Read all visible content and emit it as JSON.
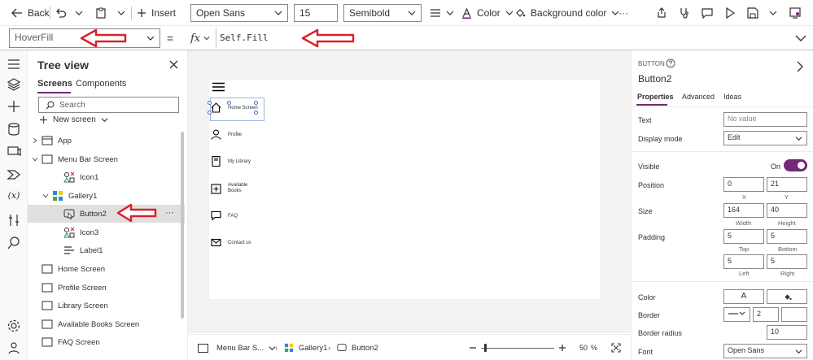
{
  "toolbar": {
    "back_label": "Back",
    "insert_label": "Insert",
    "font_family": "Open Sans",
    "font_size": "15",
    "font_weight": "Semibold",
    "color_label": "Color",
    "background_color_label": "Background color",
    "more_label": "···"
  },
  "formula_bar": {
    "property": "HoverFill",
    "equals": "=",
    "fx": "fx",
    "formula": "Self.Fill"
  },
  "tree": {
    "title": "Tree view",
    "tabs": [
      "Screens",
      "Components"
    ],
    "search_placeholder": "Search",
    "new_screen_label": "New screen",
    "items": [
      {
        "label": "App"
      },
      {
        "label": "Menu Bar Screen"
      },
      {
        "label": "Icon1"
      },
      {
        "label": "Gallery1"
      },
      {
        "label": "Button2"
      },
      {
        "label": "Icon3"
      },
      {
        "label": "Label1"
      },
      {
        "label": "Home Screen"
      },
      {
        "label": "Profile Screen"
      },
      {
        "label": "Library Screen"
      },
      {
        "label": "Available Books Screen"
      },
      {
        "label": "FAQ Screen"
      }
    ],
    "more_label": "···"
  },
  "canvas": {
    "menu": [
      {
        "label": "Home Screen",
        "icon": "home-icon"
      },
      {
        "label": "Profile",
        "icon": "person-icon"
      },
      {
        "label": "My Library",
        "icon": "book-icon"
      },
      {
        "label": "Available Books",
        "icon": "add-box-icon"
      },
      {
        "label": "FAQ",
        "icon": "chat-icon"
      },
      {
        "label": "Contact us",
        "icon": "mail-icon"
      }
    ]
  },
  "bottombar": {
    "crumbs": [
      "Menu Bar S...",
      "Gallery1",
      "Button2"
    ],
    "zoom": "50",
    "zoom_unit": "%"
  },
  "props": {
    "type_label": "BUTTON",
    "name": "Button2",
    "tabs": [
      "Properties",
      "Advanced",
      "Ideas"
    ],
    "text_label": "Text",
    "text_placeholder": "No value",
    "display_mode_label": "Display mode",
    "display_mode": "Edit",
    "visible_label": "Visible",
    "visible_state": "On",
    "position_label": "Position",
    "pos_x": "0",
    "pos_y": "21",
    "x_label": "X",
    "y_label": "Y",
    "size_label": "Size",
    "width": "164",
    "height": "40",
    "width_label": "Width",
    "height_label": "Height",
    "padding_label": "Padding",
    "pad_top": "5",
    "pad_bottom": "5",
    "pad_left": "5",
    "pad_right": "5",
    "top_label": "Top",
    "bottom_label": "Bottom",
    "left_label": "Left",
    "right_label": "Right",
    "color_label": "Color",
    "color_a": "A",
    "border_label": "Border",
    "border_width": "2",
    "border_radius_label": "Border radius",
    "border_radius": "10",
    "font_label": "Font",
    "font_value": "Open Sans"
  },
  "colors": {
    "accent": "#742774",
    "annotation": "#d9222a"
  }
}
